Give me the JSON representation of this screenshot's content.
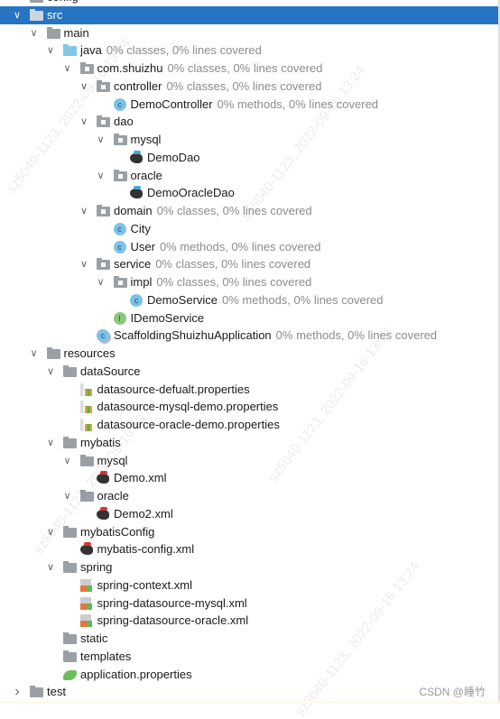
{
  "tree": {
    "rows": [
      {
        "label": "config",
        "depth": 0,
        "icon": "folder-icon",
        "arrow": "chevron-right"
      },
      {
        "label": "src",
        "depth": 0,
        "icon": "folder-icon",
        "arrow": "chevron-down",
        "selected": true
      },
      {
        "label": "main",
        "depth": 1,
        "icon": "folder-icon",
        "arrow": "chevron-down"
      },
      {
        "label": "java",
        "depth": 2,
        "icon": "source-folder-icon",
        "arrow": "chevron-down",
        "coverage": "0% classes, 0% lines covered"
      },
      {
        "label": "com.shuizhu",
        "depth": 3,
        "icon": "package-icon",
        "arrow": "chevron-down",
        "coverage": "0% classes, 0% lines covered"
      },
      {
        "label": "controller",
        "depth": 4,
        "icon": "package-icon",
        "arrow": "chevron-down",
        "coverage": "0% classes, 0% lines covered"
      },
      {
        "label": "DemoController",
        "depth": 5,
        "icon": "class-icon",
        "coverage": "0% methods, 0% lines covered"
      },
      {
        "label": "dao",
        "depth": 4,
        "icon": "package-icon",
        "arrow": "chevron-down"
      },
      {
        "label": "mysql",
        "depth": 5,
        "icon": "package-icon",
        "arrow": "chevron-down"
      },
      {
        "label": "DemoDao",
        "depth": 6,
        "icon": "mybatis-mapper-icon"
      },
      {
        "label": "oracle",
        "depth": 5,
        "icon": "package-icon",
        "arrow": "chevron-down"
      },
      {
        "label": "DemoOracleDao",
        "depth": 6,
        "icon": "mybatis-mapper-icon"
      },
      {
        "label": "domain",
        "depth": 4,
        "icon": "package-icon",
        "arrow": "chevron-down",
        "coverage": "0% classes, 0% lines covered"
      },
      {
        "label": "City",
        "depth": 5,
        "icon": "class-icon"
      },
      {
        "label": "User",
        "depth": 5,
        "icon": "class-icon",
        "coverage": "0% methods, 0% lines covered"
      },
      {
        "label": "service",
        "depth": 4,
        "icon": "package-icon",
        "arrow": "chevron-down",
        "coverage": "0% classes, 0% lines covered"
      },
      {
        "label": "impl",
        "depth": 5,
        "icon": "package-icon",
        "arrow": "chevron-down",
        "coverage": "0% classes, 0% lines covered"
      },
      {
        "label": "DemoService",
        "depth": 6,
        "icon": "class-icon",
        "coverage": "0% methods, 0% lines covered"
      },
      {
        "label": "IDemoService",
        "depth": 5,
        "icon": "interface-icon"
      },
      {
        "label": "ScaffoldingShuizhuApplication",
        "depth": 4,
        "icon": "spring-boot-class-icon",
        "coverage": "0% methods, 0% lines covered"
      },
      {
        "label": "resources",
        "depth": 1,
        "icon": "folder-icon",
        "arrow": "chevron-down"
      },
      {
        "label": "dataSource",
        "depth": 2,
        "icon": "folder-icon",
        "arrow": "chevron-down"
      },
      {
        "label": "datasource-defualt.properties",
        "depth": 3,
        "icon": "properties-file-icon"
      },
      {
        "label": "datasource-mysql-demo.properties",
        "depth": 3,
        "icon": "properties-file-icon"
      },
      {
        "label": "datasource-oracle-demo.properties",
        "depth": 3,
        "icon": "properties-file-icon"
      },
      {
        "label": "mybatis",
        "depth": 2,
        "icon": "folder-icon",
        "arrow": "chevron-down"
      },
      {
        "label": "mysql",
        "depth": 3,
        "icon": "folder-icon",
        "arrow": "chevron-down"
      },
      {
        "label": "Demo.xml",
        "depth": 4,
        "icon": "mybatis-xml-icon"
      },
      {
        "label": "oracle",
        "depth": 3,
        "icon": "folder-icon",
        "arrow": "chevron-down"
      },
      {
        "label": "Demo2.xml",
        "depth": 4,
        "icon": "mybatis-xml-icon"
      },
      {
        "label": "mybatisConfig",
        "depth": 2,
        "icon": "folder-icon",
        "arrow": "chevron-down"
      },
      {
        "label": "mybatis-config.xml",
        "depth": 3,
        "icon": "mybatis-xml-icon"
      },
      {
        "label": "spring",
        "depth": 2,
        "icon": "folder-icon",
        "arrow": "chevron-down"
      },
      {
        "label": "spring-context.xml",
        "depth": 3,
        "icon": "spring-xml-icon"
      },
      {
        "label": "spring-datasource-mysql.xml",
        "depth": 3,
        "icon": "spring-xml-icon"
      },
      {
        "label": "spring-datasource-oracle.xml",
        "depth": 3,
        "icon": "spring-xml-icon"
      },
      {
        "label": "static",
        "depth": 2,
        "icon": "folder-icon"
      },
      {
        "label": "templates",
        "depth": 2,
        "icon": "folder-icon"
      },
      {
        "label": "application.properties",
        "depth": 2,
        "icon": "spring-properties-icon"
      },
      {
        "label": "test",
        "depth": 0,
        "icon": "folder-icon",
        "arrow": "chevron-right"
      }
    ]
  },
  "watermark": "sz5040-1123, 2022-09-16 13:24",
  "credit": "CSDN @睡竹",
  "colors": {
    "selection": "#2675c2",
    "coverage_text": "#8c8c8c"
  }
}
